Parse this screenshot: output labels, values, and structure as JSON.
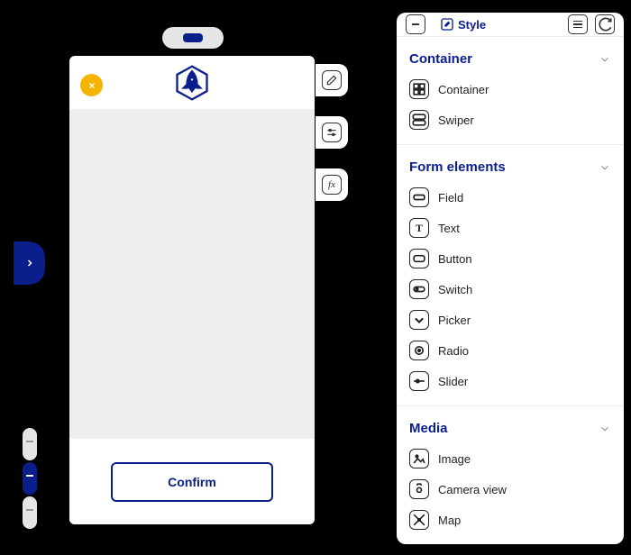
{
  "canvas": {
    "confirm_label": "Confirm"
  },
  "panel": {
    "style_tab_label": "Style",
    "sections": {
      "container": {
        "title": "Container",
        "items": [
          {
            "label": "Container"
          },
          {
            "label": "Swiper"
          }
        ]
      },
      "form": {
        "title": "Form elements",
        "items": [
          {
            "label": "Field"
          },
          {
            "label": "Text"
          },
          {
            "label": "Button"
          },
          {
            "label": "Switch"
          },
          {
            "label": "Picker"
          },
          {
            "label": "Radio"
          },
          {
            "label": "Slider"
          }
        ]
      },
      "media": {
        "title": "Media",
        "items": [
          {
            "label": "Image"
          },
          {
            "label": "Camera view"
          },
          {
            "label": "Map"
          }
        ]
      }
    }
  }
}
